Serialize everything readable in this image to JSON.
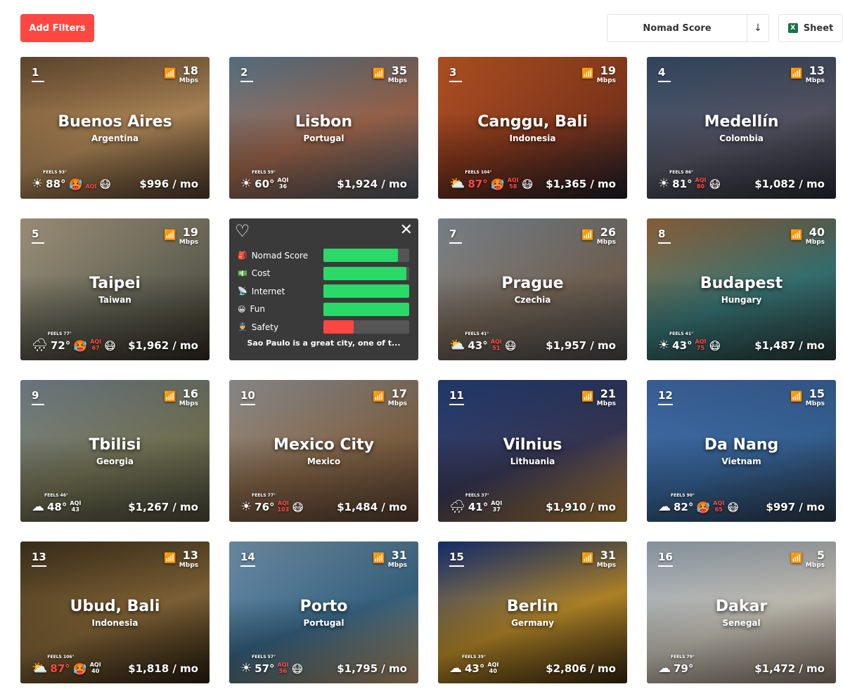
{
  "toolbar": {
    "filters_label": "Add Filters",
    "sort_label": "Nomad Score",
    "sort_direction": "↓",
    "sheet_label": "Sheet"
  },
  "cards": [
    {
      "rank": "1",
      "speed": "18",
      "unit": "Mbps",
      "city": "Buenos Aires",
      "country": "Argentina",
      "feels": "FEELS 93°",
      "temp": "88°",
      "hot": false,
      "aqi_label": "AQI",
      "aqi_value": "",
      "aqi_bad": true,
      "weather": "☀",
      "face": "😷",
      "face2": "🥵",
      "cost": "$996 / mo",
      "bg": [
        "#7a5a3a",
        "#b98f5c",
        "#4d3a2a"
      ]
    },
    {
      "rank": "2",
      "speed": "35",
      "unit": "Mbps",
      "city": "Lisbon",
      "country": "Portugal",
      "feels": "FEELS 59°",
      "temp": "60°",
      "hot": false,
      "aqi_label": "AQI",
      "aqi_value": "36",
      "aqi_bad": false,
      "weather": "☀",
      "face": "",
      "face2": "",
      "cost": "$1,924 / mo",
      "bg": [
        "#6e8fa6",
        "#a56a4e",
        "#4a5966"
      ]
    },
    {
      "rank": "3",
      "speed": "19",
      "unit": "Mbps",
      "city": "Canggu, Bali",
      "country": "Indonesia",
      "feels": "FEELS 104°",
      "temp": "87°",
      "hot": true,
      "aqi_label": "AQI",
      "aqi_value": "58",
      "aqi_bad": true,
      "weather": "⛅",
      "face": "😷",
      "face2": "🥵",
      "cost": "$1,365 / mo",
      "bg": [
        "#e0662a",
        "#8a3a1e",
        "#1e1e2a"
      ]
    },
    {
      "rank": "4",
      "speed": "13",
      "unit": "Mbps",
      "city": "Medellín",
      "country": "Colombia",
      "feels": "FEELS 86°",
      "temp": "81°",
      "hot": false,
      "aqi_label": "AQI",
      "aqi_value": "80",
      "aqi_bad": true,
      "weather": "☀",
      "face": "😷",
      "face2": "",
      "cost": "$1,082 / mo",
      "bg": [
        "#405a78",
        "#5a5a6a",
        "#2a2a36"
      ]
    },
    {
      "rank": "5",
      "speed": "19",
      "unit": "Mbps",
      "city": "Taipei",
      "country": "Taiwan",
      "feels": "FEELS 77°",
      "temp": "72°",
      "hot": false,
      "aqi_label": "AQI",
      "aqi_value": "67",
      "aqi_bad": true,
      "weather": "🌧",
      "face": "😷",
      "face2": "🥵",
      "cost": "$1,962 / mo",
      "bg": [
        "#c9b89a",
        "#6a6a5a",
        "#2e2a1e"
      ]
    },
    {
      "rank": "7",
      "speed": "26",
      "unit": "Mbps",
      "city": "Prague",
      "country": "Czechia",
      "feels": "FEELS 41°",
      "temp": "43°",
      "hot": false,
      "aqi_label": "AQI",
      "aqi_value": "51",
      "aqi_bad": true,
      "weather": "⛅",
      "face": "😷",
      "face2": "",
      "cost": "$1,957 / mo",
      "bg": [
        "#9aa6b0",
        "#7a6a5a",
        "#4a4a4a"
      ]
    },
    {
      "rank": "8",
      "speed": "40",
      "unit": "Mbps",
      "city": "Budapest",
      "country": "Hungary",
      "feels": "FEELS 41°",
      "temp": "43°",
      "hot": false,
      "aqi_label": "AQI",
      "aqi_value": "75",
      "aqi_bad": true,
      "weather": "☀",
      "face": "😷",
      "face2": "",
      "cost": "$1,487 / mo",
      "bg": [
        "#b07a4a",
        "#3a7a7a",
        "#2a3a3a"
      ]
    },
    {
      "rank": "9",
      "speed": "16",
      "unit": "Mbps",
      "city": "Tbilisi",
      "country": "Georgia",
      "feels": "FEELS 46°",
      "temp": "48°",
      "hot": false,
      "aqi_label": "AQI",
      "aqi_value": "43",
      "aqi_bad": false,
      "weather": "☁",
      "face": "",
      "face2": "",
      "cost": "$1,267 / mo",
      "bg": [
        "#8a9aa6",
        "#7a7a5a",
        "#4a4a3a"
      ]
    },
    {
      "rank": "10",
      "speed": "17",
      "unit": "Mbps",
      "city": "Mexico City",
      "country": "Mexico",
      "feels": "FEELS 77°",
      "temp": "76°",
      "hot": false,
      "aqi_label": "AQI",
      "aqi_value": "103",
      "aqi_bad": true,
      "weather": "☀",
      "face": "😷",
      "face2": "",
      "cost": "$1,484 / mo",
      "bg": [
        "#b0b0b0",
        "#8a6a4a",
        "#5a4030"
      ]
    },
    {
      "rank": "11",
      "speed": "21",
      "unit": "Mbps",
      "city": "Vilnius",
      "country": "Lithuania",
      "feels": "FEELS 37°",
      "temp": "41°",
      "hot": false,
      "aqi_label": "AQI",
      "aqi_value": "37",
      "aqi_bad": false,
      "weather": "🌧",
      "face": "",
      "face2": "",
      "cost": "$1,910 / mo",
      "bg": [
        "#2a4a8a",
        "#3a3a5a",
        "#c08a3a"
      ]
    },
    {
      "rank": "12",
      "speed": "15",
      "unit": "Mbps",
      "city": "Da Nang",
      "country": "Vietnam",
      "feels": "FEELS 90°",
      "temp": "82°",
      "hot": false,
      "aqi_label": "AQI",
      "aqi_value": "65",
      "aqi_bad": true,
      "weather": "☁",
      "face": "😷",
      "face2": "🥵",
      "cost": "$997 / mo",
      "bg": [
        "#4a7ac0",
        "#3a6aa0",
        "#2a3a4a"
      ]
    },
    {
      "rank": "13",
      "speed": "13",
      "unit": "Mbps",
      "city": "Ubud, Bali",
      "country": "Indonesia",
      "feels": "FEELS 106°",
      "temp": "87°",
      "hot": true,
      "aqi_label": "AQI",
      "aqi_value": "40",
      "aqi_bad": false,
      "weather": "⛅",
      "face": "",
      "face2": "🥵",
      "cost": "$1,818 / mo",
      "bg": [
        "#4a3a20",
        "#8a6a3a",
        "#2a2010"
      ]
    },
    {
      "rank": "14",
      "speed": "31",
      "unit": "Mbps",
      "city": "Porto",
      "country": "Portugal",
      "feels": "FEELS 57°",
      "temp": "57°",
      "hot": false,
      "aqi_label": "AQI",
      "aqi_value": "56",
      "aqi_bad": true,
      "weather": "☀",
      "face": "😷",
      "face2": "",
      "cost": "$1,795 / mo",
      "bg": [
        "#8ab0d0",
        "#3a6a8a",
        "#c09a6a"
      ]
    },
    {
      "rank": "15",
      "speed": "31",
      "unit": "Mbps",
      "city": "Berlin",
      "country": "Germany",
      "feels": "FEELS 39°",
      "temp": "43°",
      "hot": false,
      "aqi_label": "AQI",
      "aqi_value": "40",
      "aqi_bad": false,
      "weather": "☁",
      "face": "",
      "face2": "",
      "cost": "$2,806 / mo",
      "bg": [
        "#1a3a8a",
        "#c0902a",
        "#3a2a10"
      ]
    },
    {
      "rank": "16",
      "speed": "5",
      "unit": "Mbps",
      "city": "Dakar",
      "country": "Senegal",
      "feels": "FEELS 79°",
      "temp": "79°",
      "hot": false,
      "aqi_label": "",
      "aqi_value": "",
      "aqi_bad": false,
      "weather": "☁",
      "face": "",
      "face2": "",
      "cost": "$1,472 / mo",
      "bg": [
        "#b0c0d0",
        "#d0ccc0",
        "#8a7a6a"
      ]
    }
  ],
  "detail": {
    "position_after": 5,
    "heart": "♡",
    "close": "✕",
    "bars": [
      {
        "icon": "🎒",
        "label": "Nomad Score",
        "level": 0.87,
        "color": "#2ad967"
      },
      {
        "icon": "💵",
        "label": "Cost",
        "level": 0.97,
        "color": "#2ad967"
      },
      {
        "icon": "📡",
        "label": "Internet",
        "level": 1.0,
        "color": "#2ad967"
      },
      {
        "icon": "😀",
        "label": "Fun",
        "level": 1.0,
        "color": "#2ad967"
      },
      {
        "icon": "👮",
        "label": "Safety",
        "level": 0.35,
        "color": "#ff4742"
      }
    ],
    "description": "Sao Paulo is a great city, one of t..."
  }
}
